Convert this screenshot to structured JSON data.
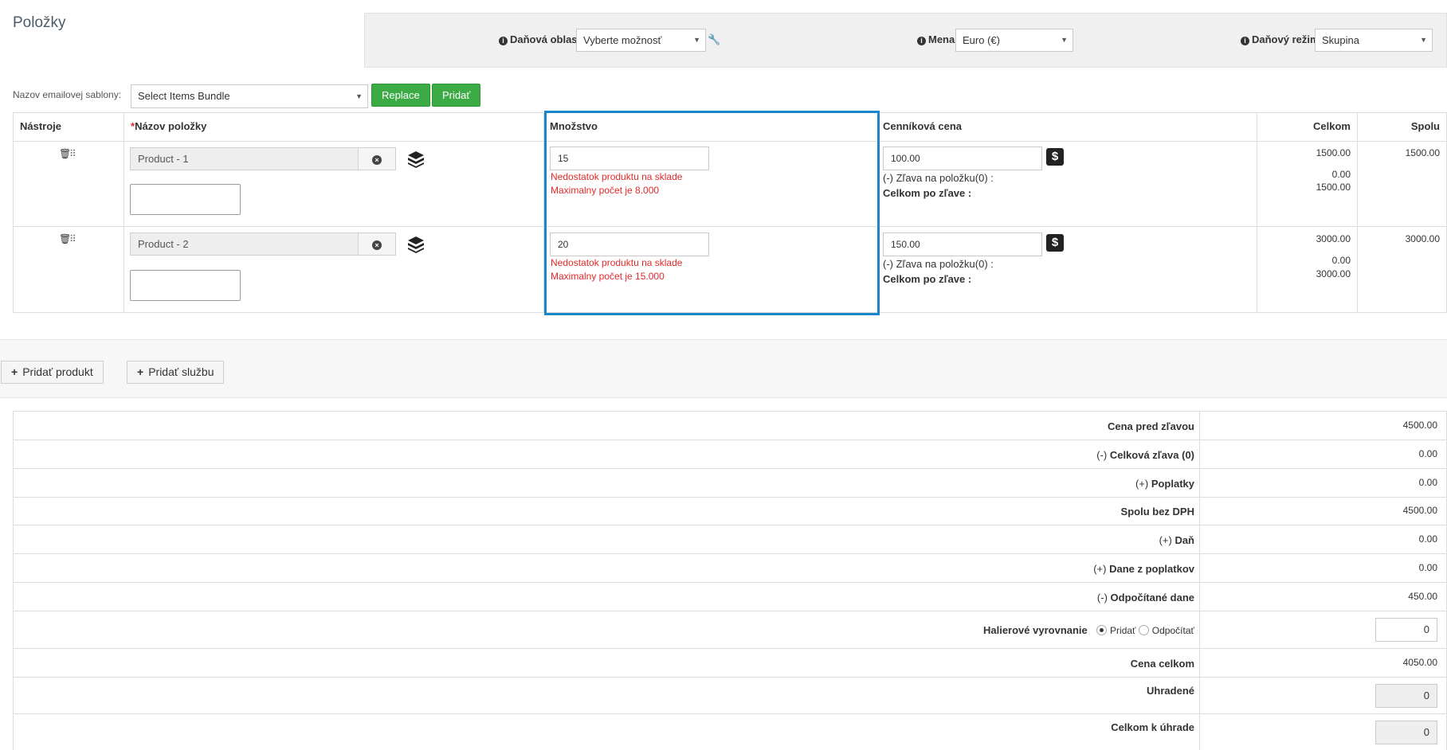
{
  "page": {
    "title": "Položky"
  },
  "topbar": {
    "tax_region_label": "Daňová oblasť",
    "tax_region_value": "Vyberte možnosť",
    "currency_label": "Mena",
    "currency_value": "Euro (€)",
    "tax_mode_label": "Daňový režim",
    "tax_mode_value": "Skupina"
  },
  "template": {
    "label": "Nazov emailovej sablony:",
    "select_value": "Select Items Bundle",
    "replace_label": "Replace",
    "add_label": "Pridať"
  },
  "table": {
    "headers": {
      "tools": "Nástroje",
      "name_required": "*",
      "name": "Názov položky",
      "quantity": "Množstvo",
      "list_price": "Cenníková cena",
      "total": "Celkom",
      "sum": "Spolu"
    },
    "discount_label": "(-) Zľava na položku(0) :",
    "after_discount_label": "Celkom po zľave :",
    "rows": [
      {
        "product": "Product - 1",
        "quantity": "15",
        "error1": "Nedostatok produktu na sklade",
        "error2": "Maximalny počet je 8.000",
        "price": "100.00",
        "total": "1500.00",
        "discount": "0.00",
        "after_discount": "1500.00",
        "sum": "1500.00"
      },
      {
        "product": "Product - 2",
        "quantity": "20",
        "error1": "Nedostatok produktu na sklade",
        "error2": "Maximalny počet je 15.000",
        "price": "150.00",
        "total": "3000.00",
        "discount": "0.00",
        "after_discount": "3000.00",
        "sum": "3000.00"
      }
    ]
  },
  "actions": {
    "add_product": "Pridať produkt",
    "add_service": "Pridať službu"
  },
  "summary": {
    "price_before_discount": {
      "label": "Cena pred zľavou",
      "value": "4500.00"
    },
    "total_discount": {
      "prefix": "(-)",
      "label": "Celková zľava (0)",
      "value": "0.00"
    },
    "fees": {
      "prefix": "(+)",
      "label": "Poplatky",
      "value": "0.00"
    },
    "total_no_vat": {
      "label": "Spolu bez DPH",
      "value": "4500.00"
    },
    "tax": {
      "prefix": "(+)",
      "label": "Daň",
      "value": "0.00"
    },
    "fee_tax": {
      "prefix": "(+)",
      "label": "Dane z poplatkov",
      "value": "0.00"
    },
    "deducted_tax": {
      "prefix": "(-)",
      "label": "Odpočítané dane",
      "value": "450.00"
    },
    "rounding": {
      "label": "Halierové vyrovnanie",
      "opt_add": "Pridať",
      "opt_sub": "Odpočítať",
      "value": "0"
    },
    "grand_total": {
      "label": "Cena celkom",
      "value": "4050.00"
    },
    "paid": {
      "label": "Uhradené",
      "value": "0"
    },
    "to_pay": {
      "label": "Celkom k úhrade",
      "value": "0"
    }
  },
  "colors": {
    "green": "#3cab46",
    "highlight": "#1a86c9",
    "error": "#e02a2a"
  }
}
